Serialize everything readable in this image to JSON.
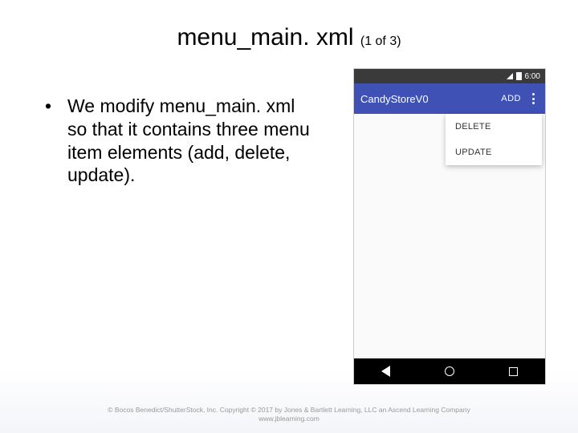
{
  "title": {
    "main": "menu_main. xml",
    "sub": "(1 of 3)"
  },
  "bullet": {
    "marker": "•",
    "text": "We modify menu_main. xml so that it contains three menu item elements (add, delete, update)."
  },
  "phone": {
    "status_time": "6:00",
    "appbar_title": "CandyStoreV0",
    "appbar_action": "ADD",
    "menu": {
      "item1": "DELETE",
      "item2": "UPDATE"
    }
  },
  "footer": {
    "line1": "© Bocos Benedict/ShutterStock, Inc. Copyright © 2017 by Jones & Bartlett Learning, LLC an Ascend Learning Company",
    "line2": "www.jblearning.com"
  }
}
